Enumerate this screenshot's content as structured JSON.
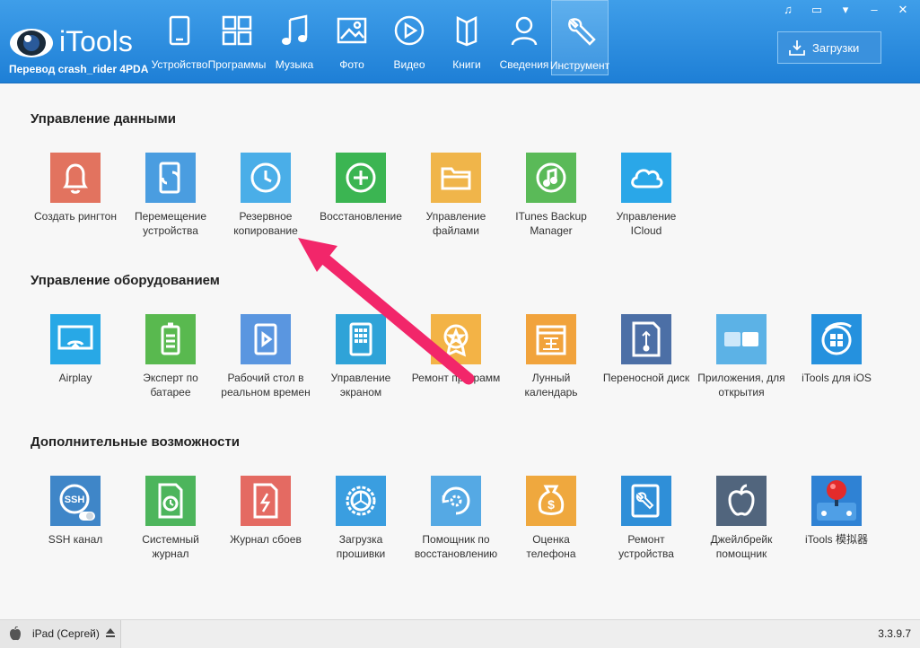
{
  "app": {
    "logo_text": "iTools",
    "subtitle": "Перевод crash_rider 4PDA",
    "downloads_label": "Загрузки",
    "version": "3.3.9.7",
    "device": "iPad (Сергей)"
  },
  "nav": [
    {
      "label": "Устройство",
      "icon": "tablet-icon"
    },
    {
      "label": "Программы",
      "icon": "apps-grid-icon"
    },
    {
      "label": "Музыка",
      "icon": "music-note-icon"
    },
    {
      "label": "Фото",
      "icon": "photo-icon"
    },
    {
      "label": "Видео",
      "icon": "play-icon"
    },
    {
      "label": "Книги",
      "icon": "book-icon"
    },
    {
      "label": "Сведения",
      "icon": "person-icon"
    },
    {
      "label": "Инструмент",
      "icon": "wrench-icon",
      "active": true
    }
  ],
  "sections": {
    "data_mgmt": {
      "title": "Управление данными",
      "items": [
        {
          "label": "Создать рингтон",
          "color": "#e2735f",
          "icon": "bell-icon"
        },
        {
          "label": "Перемещение устройства",
          "color": "#4a9de0",
          "icon": "phone-transfer-icon"
        },
        {
          "label": "Резервное копирование",
          "color": "#4aaee8",
          "icon": "clock-icon"
        },
        {
          "label": "Восстановление",
          "color": "#3bb552",
          "icon": "restore-icon"
        },
        {
          "label": "Управление файлами",
          "color": "#f0b54a",
          "icon": "folder-icon"
        },
        {
          "label": "ITunes Backup Manager",
          "color": "#5aba58",
          "icon": "music-circle-icon"
        },
        {
          "label": "Управление ICloud",
          "color": "#2aa7e8",
          "icon": "cloud-icon"
        }
      ]
    },
    "hw_mgmt": {
      "title": "Управление оборудованием",
      "items": [
        {
          "label": "Airplay",
          "color": "#28a8e6",
          "icon": "airplay-icon"
        },
        {
          "label": "Эксперт по батарее",
          "color": "#59b94f",
          "icon": "battery-icon"
        },
        {
          "label": "Рабочий стол в реальном времен",
          "color": "#5a96e0",
          "icon": "phone-play-icon"
        },
        {
          "label": "Управление экраном",
          "color": "#2fa3d8",
          "icon": "phone-grid-icon"
        },
        {
          "label": "Ремонт программ",
          "color": "#f3b346",
          "icon": "badge-star-icon"
        },
        {
          "label": "Лунный календарь",
          "color": "#f1a33c",
          "icon": "calendar-icon"
        },
        {
          "label": "Переносной диск",
          "color": "#4c6fa6",
          "icon": "usb-drive-icon"
        },
        {
          "label": "Приложения, для открытия",
          "color": "#5cb2e6",
          "icon": "squares-icon"
        },
        {
          "label": "iTools для iOS",
          "color": "#2591de",
          "icon": "itools-logo-icon"
        }
      ]
    },
    "extra": {
      "title": "Дополнительные возможности",
      "items": [
        {
          "label": "SSH канал",
          "color": "#3f86c8",
          "icon": "ssh-icon"
        },
        {
          "label": "Системный журнал",
          "color": "#4db55c",
          "icon": "log-clock-icon"
        },
        {
          "label": "Журнал сбоев",
          "color": "#e46a62",
          "icon": "crash-log-icon"
        },
        {
          "label": "Загрузка прошивки",
          "color": "#3a9ee0",
          "icon": "gear-icon"
        },
        {
          "label": "Помощник по восстановлению",
          "color": "#55a9e4",
          "icon": "restore-gear-icon"
        },
        {
          "label": "Оценка телефона",
          "color": "#efa83e",
          "icon": "money-bag-icon"
        },
        {
          "label": "Ремонт устройства",
          "color": "#2f8fd8",
          "icon": "tablet-wrench-icon"
        },
        {
          "label": "Джейлбрейк помощник",
          "color": "#51657d",
          "icon": "apple-icon"
        },
        {
          "label": "iTools 模拟器",
          "color": "#2f82d4",
          "icon": "joystick-icon"
        }
      ]
    }
  }
}
